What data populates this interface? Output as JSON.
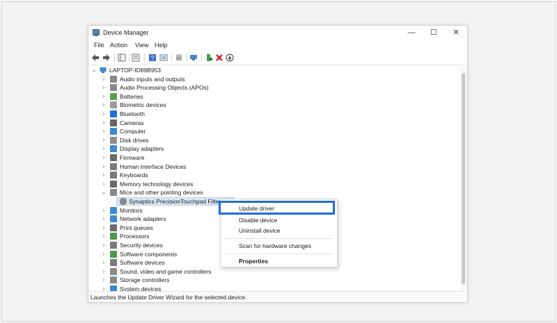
{
  "window": {
    "title": "Device Manager",
    "controls": {
      "minimize": "—",
      "maximize": "☐",
      "close": "✕"
    }
  },
  "menu": [
    "File",
    "Action",
    "View",
    "Help"
  ],
  "tree": {
    "root": "LAPTOP-ID89B953",
    "categories": [
      {
        "label": "Audio inputs and outputs",
        "icon": "speaker-icon",
        "color": "#8a8a8a"
      },
      {
        "label": "Audio Processing Objects (APOs)",
        "icon": "speaker-icon",
        "color": "#8a8a8a"
      },
      {
        "label": "Batteries",
        "icon": "battery-icon",
        "color": "#5aa04a"
      },
      {
        "label": "Biometric devices",
        "icon": "fingerprint-icon",
        "color": "#9a9a9a"
      },
      {
        "label": "Bluetooth",
        "icon": "bluetooth-icon",
        "color": "#1e6fd9"
      },
      {
        "label": "Cameras",
        "icon": "camera-icon",
        "color": "#666666"
      },
      {
        "label": "Computer",
        "icon": "monitor-icon",
        "color": "#3a8ad6"
      },
      {
        "label": "Disk drives",
        "icon": "disk-drive-icon",
        "color": "#8c8c8c"
      },
      {
        "label": "Display adapters",
        "icon": "display-adapter-icon",
        "color": "#3a8ad6"
      },
      {
        "label": "Firmware",
        "icon": "firmware-icon",
        "color": "#6a6a6a"
      },
      {
        "label": "Human Interface Devices",
        "icon": "hid-icon",
        "color": "#7a7a7a"
      },
      {
        "label": "Keyboards",
        "icon": "keyboard-icon",
        "color": "#7a7a7a"
      },
      {
        "label": "Memory technology devices",
        "icon": "memory-icon",
        "color": "#6a6a6a"
      },
      {
        "label": "Mice and other pointing devices",
        "icon": "mouse-icon",
        "color": "#8a8a8a",
        "expanded": true,
        "children": [
          {
            "label": "Synaptics PrecisionTouchpad Filter D...",
            "icon": "mouse-icon",
            "color": "#8a8a8a",
            "selected": true
          }
        ]
      },
      {
        "label": "Monitors",
        "icon": "monitor-icon",
        "color": "#3a8ad6"
      },
      {
        "label": "Network adapters",
        "icon": "network-icon",
        "color": "#3a8ad6"
      },
      {
        "label": "Print queues",
        "icon": "printer-icon",
        "color": "#6a6a6a"
      },
      {
        "label": "Processors",
        "icon": "processor-icon",
        "color": "#4a9a4a"
      },
      {
        "label": "Security devices",
        "icon": "security-icon",
        "color": "#7a7a7a"
      },
      {
        "label": "Software components",
        "icon": "software-icon",
        "color": "#4a9a4a"
      },
      {
        "label": "Software devices",
        "icon": "software-icon",
        "color": "#7a7a7a"
      },
      {
        "label": "Sound, video and game controllers",
        "icon": "speaker-icon",
        "color": "#8a8a8a"
      },
      {
        "label": "Storage controllers",
        "icon": "storage-icon",
        "color": "#8a8a8a"
      },
      {
        "label": "System devices",
        "icon": "system-icon",
        "color": "#3a8ad6"
      }
    ]
  },
  "context_menu": {
    "items": [
      {
        "label": "Update driver",
        "highlighted": true
      },
      {
        "label": "Disable device"
      },
      {
        "label": "Uninstall device"
      },
      {
        "label": "Scan for hardware changes"
      },
      {
        "label": "Properties",
        "bold": true
      }
    ]
  },
  "status": "Launches the Update Driver Wizard for the selected device.",
  "colors": {
    "highlight_border": "#1d6ae0",
    "selection_bg": "#dbe8f7"
  }
}
